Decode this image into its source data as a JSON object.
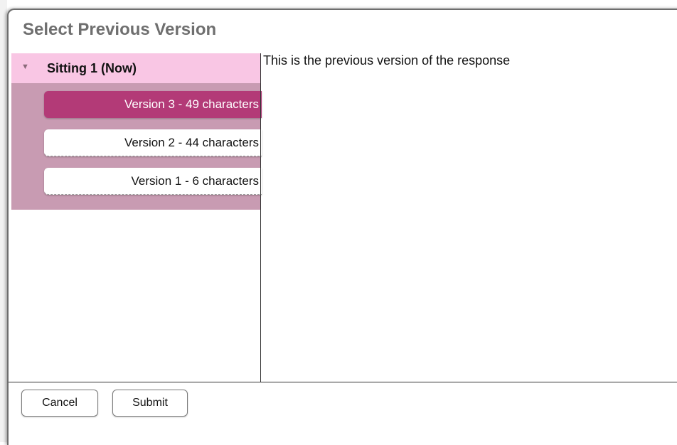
{
  "dialog": {
    "title": "Select Previous Version"
  },
  "sitting": {
    "label": "Sitting 1 (Now)",
    "expanded": true,
    "caret_icon": "triangle-down-icon"
  },
  "versions": [
    {
      "label": "Version 3 - 49 characters",
      "selected": true
    },
    {
      "label": "Version 2 - 44 characters",
      "selected": false
    },
    {
      "label": "Version 1 - 6 characters",
      "selected": false
    }
  ],
  "preview": {
    "text": "This is the previous version of the response"
  },
  "buttons": {
    "cancel_label": "Cancel",
    "submit_label": "Submit"
  },
  "colors": {
    "sitting_header_bg": "#f9c6e4",
    "version_area_bg": "#c89bb2",
    "selected_version_bg": "#b33a77",
    "title_color": "#6f6f6f"
  }
}
